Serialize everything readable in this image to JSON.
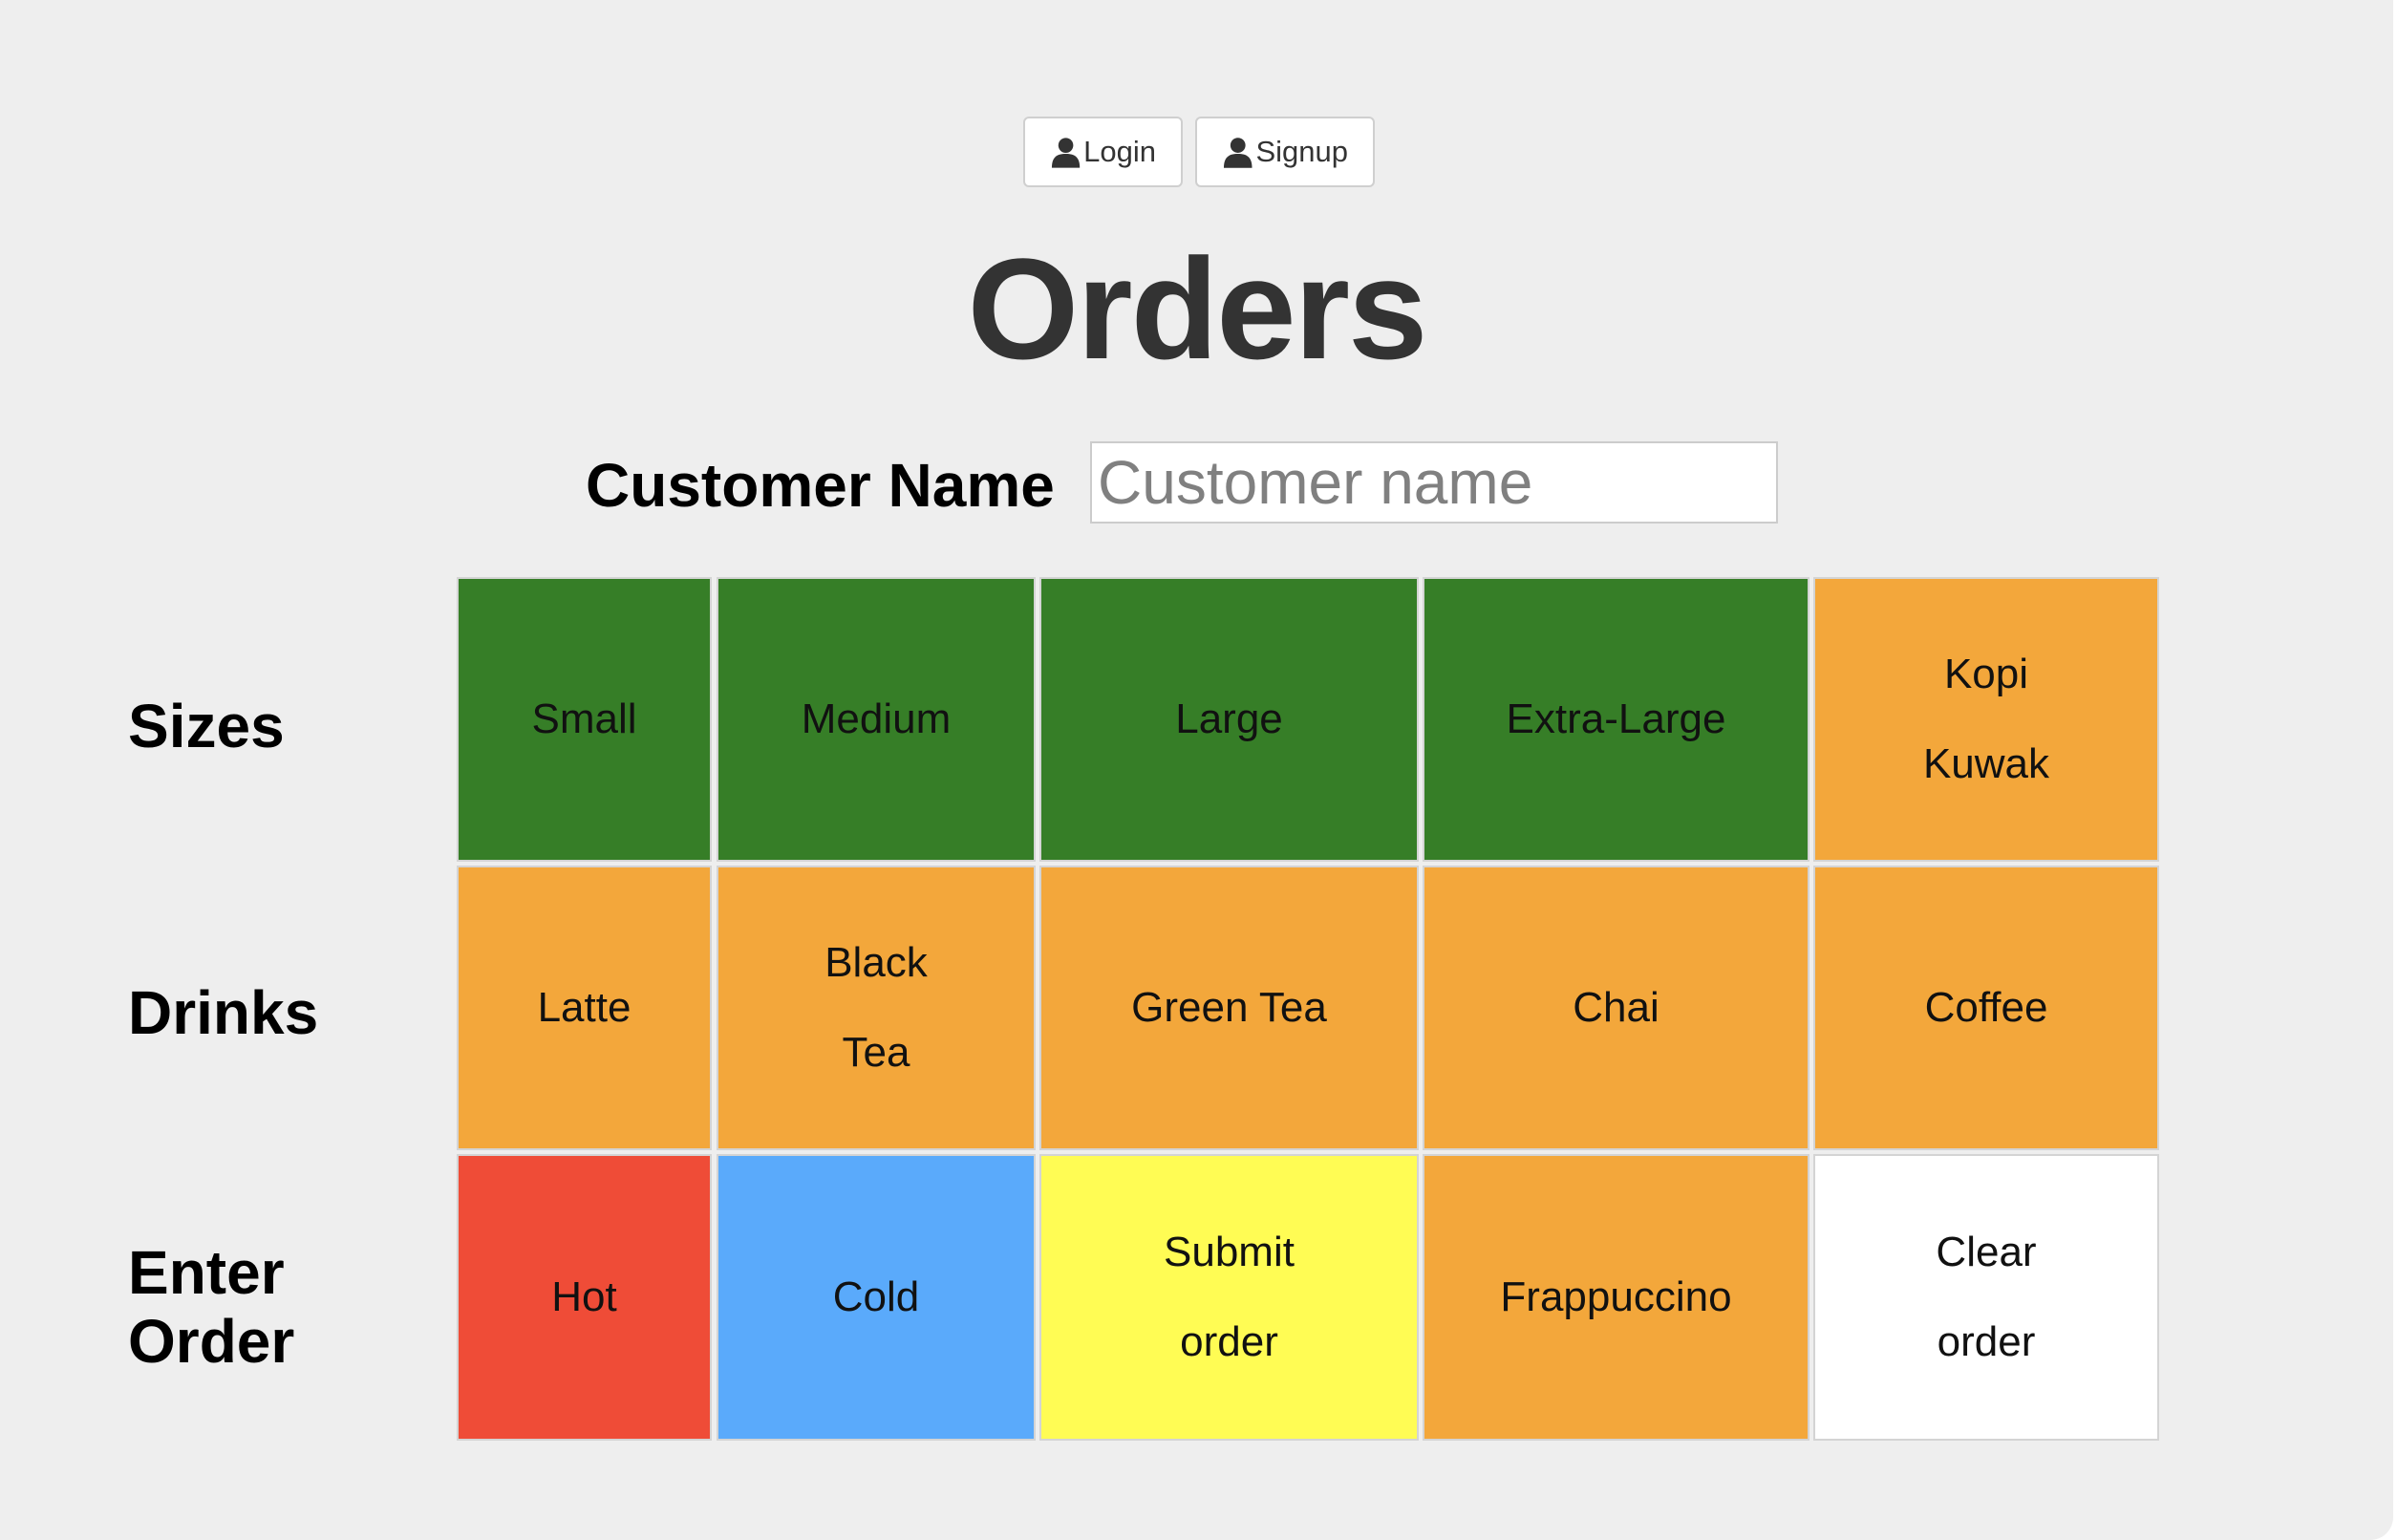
{
  "header": {
    "login_label": "Login",
    "signup_label": "Signup",
    "title": "Orders"
  },
  "customer": {
    "label": "Customer Name",
    "placeholder": "Customer name",
    "value": ""
  },
  "rows": [
    {
      "label_lines": [
        "Sizes"
      ],
      "cells": [
        {
          "lines": [
            "Small"
          ],
          "color": "#367e27"
        },
        {
          "lines": [
            "Medium"
          ],
          "color": "#367e27"
        },
        {
          "lines": [
            "Large"
          ],
          "color": "#367e27"
        },
        {
          "lines": [
            "Extra-Large"
          ],
          "color": "#367e27"
        },
        {
          "lines": [
            "Kopi",
            "Kuwak"
          ],
          "color": "#f3a73b"
        }
      ]
    },
    {
      "label_lines": [
        "Drinks"
      ],
      "cells": [
        {
          "lines": [
            "Latte"
          ],
          "color": "#f3a73b"
        },
        {
          "lines": [
            "Black",
            "Tea"
          ],
          "color": "#f3a73b"
        },
        {
          "lines": [
            "Green Tea"
          ],
          "color": "#f3a73b"
        },
        {
          "lines": [
            "Chai"
          ],
          "color": "#f3a73b"
        },
        {
          "lines": [
            "Coffee"
          ],
          "color": "#f3a73b"
        }
      ]
    },
    {
      "label_lines": [
        "Enter",
        "Order"
      ],
      "cells": [
        {
          "lines": [
            "Hot"
          ],
          "color": "#ef4c37"
        },
        {
          "lines": [
            "Cold"
          ],
          "color": "#5aaafb"
        },
        {
          "lines": [
            "Submit",
            "order"
          ],
          "color": "#fffc54"
        },
        {
          "lines": [
            "Frappuccino"
          ],
          "color": "#f3a73b"
        },
        {
          "lines": [
            "Clear",
            "order"
          ],
          "color": "#ffffff"
        }
      ]
    }
  ],
  "icons": {
    "login": "user-icon",
    "signup": "user-icon"
  }
}
